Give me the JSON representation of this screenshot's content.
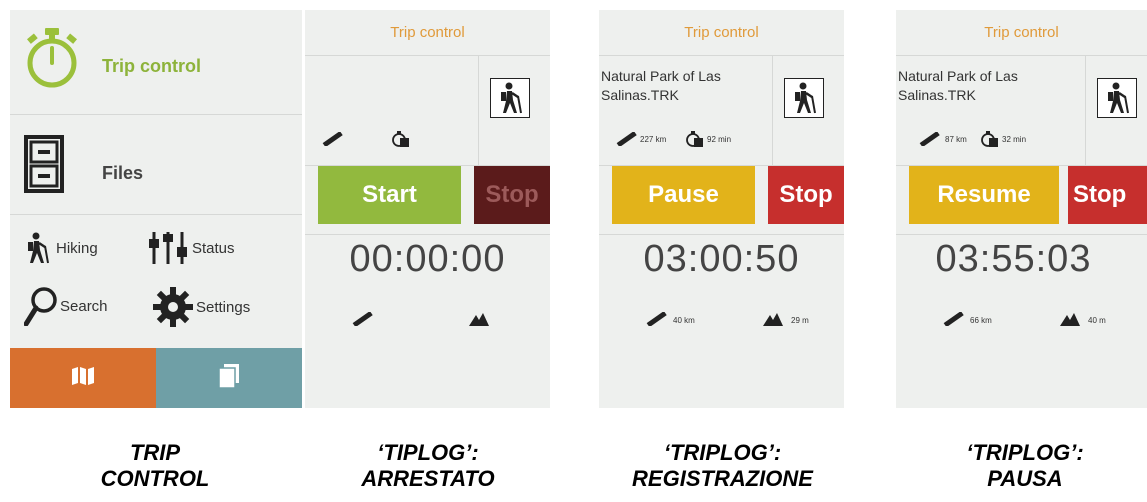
{
  "menu": {
    "trip_control_label": "Trip control",
    "files_label": "Files",
    "hiking_label": "Hiking",
    "status_label": "Status",
    "search_label": "Search",
    "settings_label": "Settings",
    "colors": {
      "accent_green": "#9bc03b",
      "map_orange": "#d8702f",
      "pages_teal": "#6f9fa6"
    }
  },
  "screens": [
    {
      "title": "Trip control",
      "track_name": "",
      "distance": "",
      "duration": "",
      "buttons": [
        {
          "label": "Start",
          "color": "#92b93e"
        },
        {
          "label": "Stop",
          "color": "#5b1b1b",
          "text_color": "#9c5a5a"
        }
      ],
      "timer": "00:00:00",
      "odometer": "",
      "altitude": ""
    },
    {
      "title": "Trip control",
      "track_name": "Natural Park of Las Salinas.TRK",
      "distance": "227 km",
      "duration": "92 min",
      "buttons": [
        {
          "label": "Pause",
          "color": "#e2b31a"
        },
        {
          "label": "Stop",
          "color": "#c62f2d"
        }
      ],
      "timer": "03:00:50",
      "odometer": "40 km",
      "altitude": "29 m"
    },
    {
      "title": "Trip control",
      "track_name": "Natural Park of Las Salinas.TRK",
      "distance": "87 km",
      "duration": "32 min",
      "buttons": [
        {
          "label": "Resume",
          "color": "#e2b31a"
        },
        {
          "label": "Stop",
          "color": "#c62f2d"
        }
      ],
      "timer": "03:55:03",
      "odometer": "66 km",
      "altitude": "40 m"
    }
  ],
  "captions": [
    {
      "line1": "TRIP",
      "line2": "CONTROL"
    },
    {
      "line1": "‘TIPLOG’:",
      "line2": "ARRESTATO"
    },
    {
      "line1": "‘TRIPLOG’:",
      "line2": "REGISTRAZIONE"
    },
    {
      "line1": "‘TRIPLOG’:",
      "line2": "PAUSA"
    }
  ]
}
